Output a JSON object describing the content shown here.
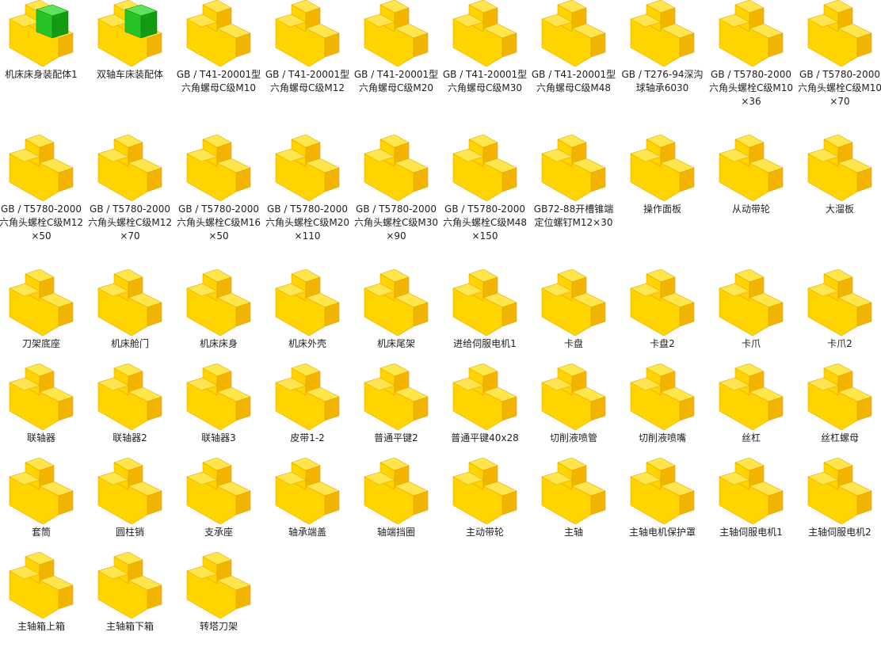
{
  "colors": {
    "part_top": "#FFE64D",
    "part_front": "#FFD400",
    "part_side": "#F2B400",
    "assembly_cube_top": "#5EE35E",
    "assembly_cube_front": "#27C427",
    "assembly_cube_side": "#149A14",
    "label_text": "#1e1e1e"
  },
  "files": [
    {
      "label": "机床床身装配体1",
      "icon": "assembly-icon",
      "type": "assembly"
    },
    {
      "label": "双轴车床装配体",
      "icon": "assembly-icon",
      "type": "assembly"
    },
    {
      "label": "GB / T41-20001型六角螺母C级M10",
      "icon": "part-icon",
      "type": "part"
    },
    {
      "label": "GB / T41-20001型六角螺母C级M12",
      "icon": "part-icon",
      "type": "part"
    },
    {
      "label": "GB / T41-20001型六角螺母C级M20",
      "icon": "part-icon",
      "type": "part"
    },
    {
      "label": "GB / T41-20001型六角螺母C级M30",
      "icon": "part-icon",
      "type": "part"
    },
    {
      "label": "GB / T41-20001型六角螺母C级M48",
      "icon": "part-icon",
      "type": "part"
    },
    {
      "label": "GB / T276-94深沟球轴承6030",
      "icon": "part-icon",
      "type": "part"
    },
    {
      "label": "GB / T5780-2000六角头螺栓C级M10×36",
      "icon": "part-icon",
      "type": "part"
    },
    {
      "label": "GB / T5780-2000六角头螺栓C级M10×70",
      "icon": "part-icon",
      "type": "part"
    },
    {
      "label": "GB / T5780-2000六角头螺栓C级M12×50",
      "icon": "part-icon",
      "type": "part"
    },
    {
      "label": "GB / T5780-2000六角头螺栓C级M12×70",
      "icon": "part-icon",
      "type": "part"
    },
    {
      "label": "GB / T5780-2000六角头螺栓C级M16×50",
      "icon": "part-icon",
      "type": "part"
    },
    {
      "label": "GB / T5780-2000六角头螺栓C级M20×110",
      "icon": "part-icon",
      "type": "part"
    },
    {
      "label": "GB / T5780-2000六角头螺栓C级M30×90",
      "icon": "part-icon",
      "type": "part"
    },
    {
      "label": "GB / T5780-2000六角头螺栓C级M48×150",
      "icon": "part-icon",
      "type": "part"
    },
    {
      "label": "GB72-88开槽锥端定位螺钉M12×30",
      "icon": "part-icon",
      "type": "part"
    },
    {
      "label": "操作面板",
      "icon": "part-icon",
      "type": "part"
    },
    {
      "label": "从动带轮",
      "icon": "part-icon",
      "type": "part"
    },
    {
      "label": "大溜板",
      "icon": "part-icon",
      "type": "part"
    },
    {
      "label": "刀架底座",
      "icon": "part-icon",
      "type": "part"
    },
    {
      "label": "机床舱门",
      "icon": "part-icon",
      "type": "part"
    },
    {
      "label": "机床床身",
      "icon": "part-icon",
      "type": "part"
    },
    {
      "label": "机床外壳",
      "icon": "part-icon",
      "type": "part"
    },
    {
      "label": "机床尾架",
      "icon": "part-icon",
      "type": "part"
    },
    {
      "label": "进给伺服电机1",
      "icon": "part-icon",
      "type": "part"
    },
    {
      "label": "卡盘",
      "icon": "part-icon",
      "type": "part"
    },
    {
      "label": "卡盘2",
      "icon": "part-icon",
      "type": "part"
    },
    {
      "label": "卡爪",
      "icon": "part-icon",
      "type": "part"
    },
    {
      "label": "卡爪2",
      "icon": "part-icon",
      "type": "part"
    },
    {
      "label": "联轴器",
      "icon": "part-icon",
      "type": "part"
    },
    {
      "label": "联轴器2",
      "icon": "part-icon",
      "type": "part"
    },
    {
      "label": "联轴器3",
      "icon": "part-icon",
      "type": "part"
    },
    {
      "label": "皮带1-2",
      "icon": "part-icon",
      "type": "part"
    },
    {
      "label": "普通平键2",
      "icon": "part-icon",
      "type": "part"
    },
    {
      "label": "普通平键40x28",
      "icon": "part-icon",
      "type": "part"
    },
    {
      "label": "切削液喷管",
      "icon": "part-icon",
      "type": "part"
    },
    {
      "label": "切削液喷嘴",
      "icon": "part-icon",
      "type": "part"
    },
    {
      "label": "丝杠",
      "icon": "part-icon",
      "type": "part"
    },
    {
      "label": "丝杠螺母",
      "icon": "part-icon",
      "type": "part"
    },
    {
      "label": "套筒",
      "icon": "part-icon",
      "type": "part"
    },
    {
      "label": "圆柱销",
      "icon": "part-icon",
      "type": "part"
    },
    {
      "label": "支承座",
      "icon": "part-icon",
      "type": "part"
    },
    {
      "label": "轴承端盖",
      "icon": "part-icon",
      "type": "part"
    },
    {
      "label": "轴端挡圈",
      "icon": "part-icon",
      "type": "part"
    },
    {
      "label": "主动带轮",
      "icon": "part-icon",
      "type": "part"
    },
    {
      "label": "主轴",
      "icon": "part-icon",
      "type": "part"
    },
    {
      "label": "主轴电机保护罩",
      "icon": "part-icon",
      "type": "part"
    },
    {
      "label": "主轴伺服电机1",
      "icon": "part-icon",
      "type": "part"
    },
    {
      "label": "主轴伺服电机2",
      "icon": "part-icon",
      "type": "part"
    },
    {
      "label": "主轴箱上箱",
      "icon": "part-icon",
      "type": "part"
    },
    {
      "label": "主轴箱下箱",
      "icon": "part-icon",
      "type": "part"
    },
    {
      "label": "转塔刀架",
      "icon": "part-icon",
      "type": "part"
    }
  ]
}
